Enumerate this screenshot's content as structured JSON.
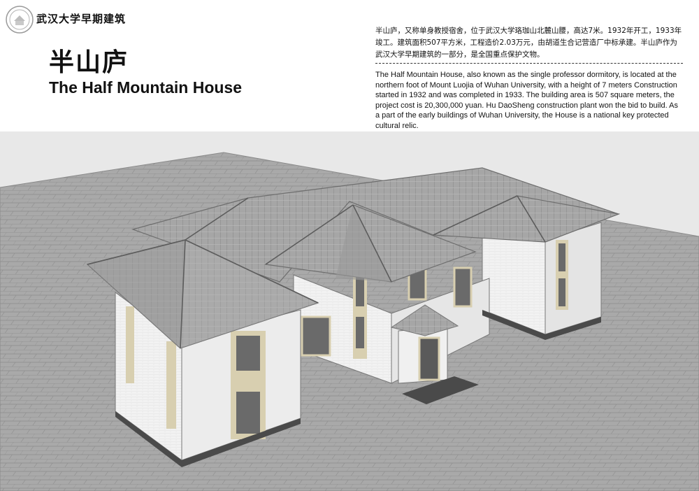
{
  "header": {
    "logo_icon": "university-seal-icon",
    "logo_title": "武汉大学早期建筑",
    "title_cn": "半山庐",
    "title_en": "The Half Mountain House"
  },
  "description": {
    "cn": "半山庐，又称单身教授宿舍，位于武汉大学珞珈山北麓山腰，高达7米。1932年开工，1933年竣工。建筑面积507平方米，工程造价2.03万元，由胡道生合记营造厂中标承建。半山庐作为武汉大学早期建筑的一部分，是全国重点保护文物。",
    "en": "The Half Mountain House, also known as the single professor dormitory, is located at the northern foot of Mount Luojia of Wuhan University, with a height of 7 meters Construction started in 1932 and was completed in 1933. The building area is 507 square meters, the project cost is 20,300,000 yuan. Hu DaoSheng construction plant won the bid to build. As a part of the early buildings of Wuhan University, the House is a national key protected cultural relic."
  },
  "colors": {
    "roof": "#a6a6a6",
    "roof_dark": "#7c7c7c",
    "wall": "#f2f2f2",
    "wall_shade": "#dcdcdc",
    "trim": "#d8cfb0",
    "window": "#6a6a6a",
    "ground": "#a9a9a9",
    "base": "#4a4a4a"
  },
  "illustration": {
    "name": "half-mountain-house-rendering"
  }
}
